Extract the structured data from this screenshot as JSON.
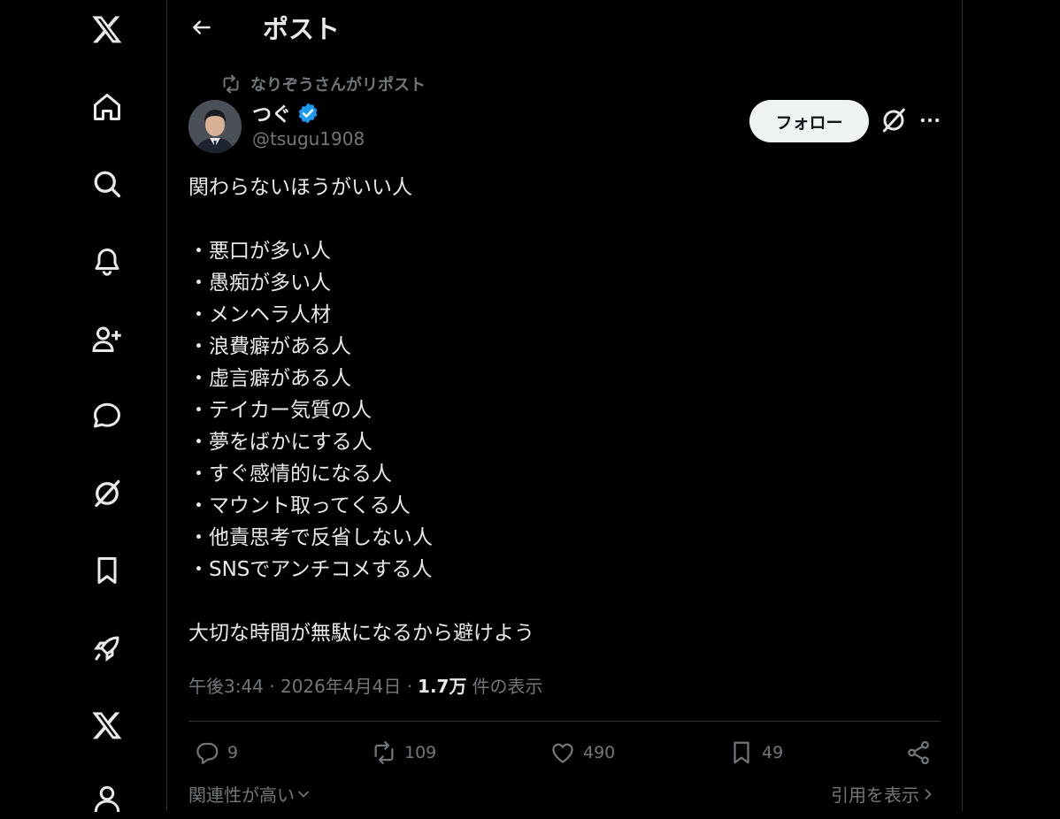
{
  "sidebar": {
    "items": [
      {
        "name": "x-logo-icon"
      },
      {
        "name": "home-icon"
      },
      {
        "name": "search-icon"
      },
      {
        "name": "notifications-icon"
      },
      {
        "name": "follow-icon"
      },
      {
        "name": "chat-icon"
      },
      {
        "name": "grok-icon"
      },
      {
        "name": "bookmark-icon"
      },
      {
        "name": "rocket-icon"
      },
      {
        "name": "premium-x-icon"
      },
      {
        "name": "profile-icon"
      }
    ]
  },
  "header": {
    "title": "ポスト"
  },
  "post": {
    "repost_context": "なりぞうさんがリポスト",
    "author": {
      "display_name": "つぐ",
      "handle": "@tsugu1908",
      "verified": true
    },
    "follow_label": "フォロー",
    "intro": "関わらないほうがいい人",
    "bullets": [
      "・悪口が多い人",
      "・愚痴が多い人",
      "・メンヘラ人材",
      "・浪費癖がある人",
      "・虚言癖がある人",
      "・テイカー気質の人",
      "・夢をばかにする人",
      "・すぐ感情的になる人",
      "・マウント取ってくる人",
      "・他責思考で反省しない人",
      "・SNSでアンチコメする人"
    ],
    "closing": "大切な時間が無駄になるから避けよう",
    "timestamp": "午後3:44 · 2026年4月4日 ·",
    "views": "1.7万",
    "views_label": "件の表示",
    "stats": {
      "replies": "9",
      "reposts": "109",
      "likes": "490",
      "bookmarks": "49"
    }
  },
  "footer": {
    "sort_label": "関連性が高い",
    "quotes_label": "引用を表示"
  },
  "colors": {
    "background": "#000000",
    "text": "#e7e9ea",
    "muted": "#71767b",
    "verified": "#1d9bf0",
    "border": "#2f3336"
  }
}
